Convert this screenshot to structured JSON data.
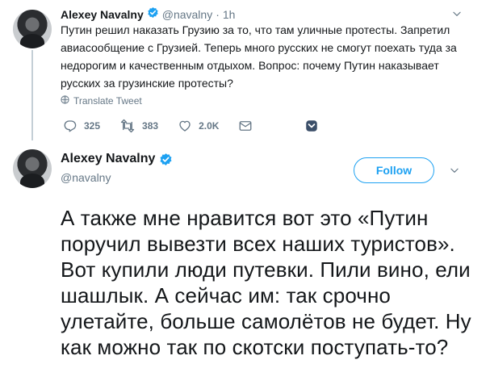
{
  "reply_tweet": {
    "author_name": "Alexey Navalny",
    "handle": "@navalny",
    "separator": "·",
    "time": "1h",
    "text": "Путин решил наказать Грузию за то, что там уличные протесты. Запретил авиасообщение с Грузией. Теперь много русских не смогут поехать туда за недорогим и качественным отдыхом. Вопрос: почему Путин наказывает русских за грузинские протесты?",
    "translate_label": "Translate Tweet",
    "reply_count": "325",
    "retweet_count": "383",
    "like_count": "2.0K"
  },
  "main_tweet": {
    "author_name": "Alexey Navalny",
    "handle": "@navalny",
    "follow_label": "Follow",
    "text": "А также мне нравится вот это «Путин поручил вывезти всех наших туристов». Вот купили люди путевки. Пили вино, ели шашлык. А сейчас им: так срочно улетайте, больше самолётов не будет. Ну как можно так по скотски поступать-то?"
  },
  "colors": {
    "accent": "#1da1f2",
    "secondary_text": "#657786",
    "primary_text": "#14171a",
    "thread_line": "#c4cfd6"
  },
  "icons": [
    "verified-badge-icon",
    "chevron-down-icon",
    "globe-icon",
    "reply-icon",
    "retweet-icon",
    "like-icon",
    "dm-icon",
    "bookmark-icon"
  ]
}
